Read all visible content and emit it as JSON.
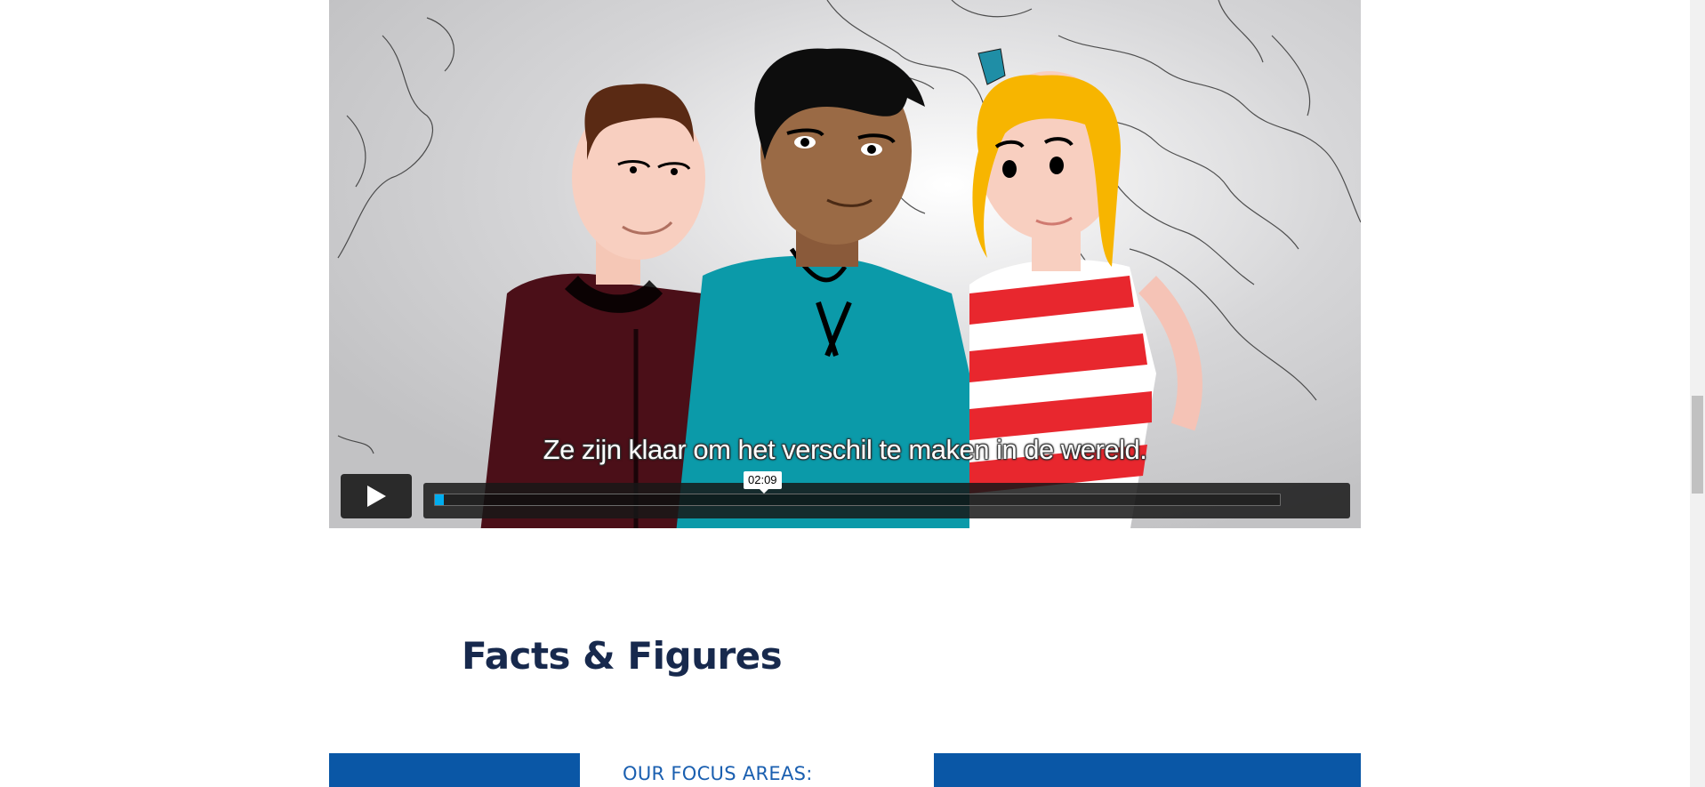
{
  "video": {
    "subtitle": "Ze zijn klaar om het verschil te maken in de wereld.",
    "hover_time": "02:09",
    "progress_fraction": 0.01,
    "volume_bars": 5,
    "accent_color": "#00adef",
    "icons": {
      "play": "play-icon",
      "volume": "volume-icon",
      "settings": "gear-icon"
    }
  },
  "section": {
    "heading": "Facts & Figures",
    "focus_label": "OUR FOCUS AREAS:"
  },
  "colors": {
    "heading": "#17294d",
    "brand_blue": "#0a57a6",
    "focus_text": "#1a5fb0"
  }
}
